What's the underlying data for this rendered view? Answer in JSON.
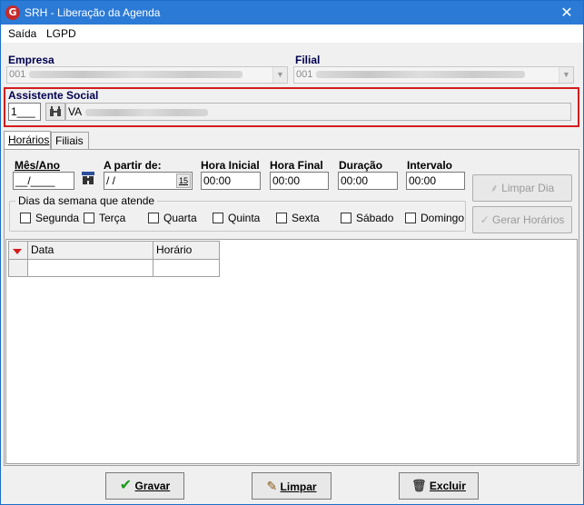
{
  "window": {
    "title": "SRH - Liberação da Agenda",
    "app_icon_glyph": "G",
    "close_glyph": "✕"
  },
  "menu": {
    "items": [
      "Saída",
      "LGPD"
    ]
  },
  "empresa": {
    "label": "Empresa",
    "value": "001"
  },
  "filial": {
    "label": "Filial",
    "value": "001"
  },
  "assistente": {
    "label": "Assistente Social",
    "code": "1___",
    "name_prefix": "VA"
  },
  "tabs": [
    {
      "label": "Horários"
    },
    {
      "label": "Filiais"
    }
  ],
  "fields": {
    "mes_ano": {
      "label": "Mês/Ano",
      "value": "__/____"
    },
    "a_partir": {
      "label": "A partir de:",
      "value": " /  /",
      "cal_glyph": "15"
    },
    "hora_inicial": {
      "label": "Hora Inicial",
      "value": "00:00"
    },
    "hora_final": {
      "label": "Hora Final",
      "value": "00:00"
    },
    "duracao": {
      "label": "Duração",
      "value": "00:00"
    },
    "intervalo": {
      "label": "Intervalo",
      "value": "00:00"
    }
  },
  "dias": {
    "legend": "Dias da semana que atende",
    "items": [
      "Segunda",
      "Terça",
      "Quarta",
      "Quinta",
      "Sexta",
      "Sábado",
      "Domingo"
    ]
  },
  "buttons": {
    "limpar_dia": "Limpar Dia",
    "gerar_horarios": "Gerar Horários",
    "gravar": "Gravar",
    "limpar": "Limpar",
    "excluir": "Excluir"
  },
  "grid": {
    "columns": [
      "Data",
      "Horário"
    ]
  },
  "colors": {
    "title_bar": "#2b7ad6",
    "highlight_border": "#d41c1c",
    "label_blue": "#000050"
  }
}
